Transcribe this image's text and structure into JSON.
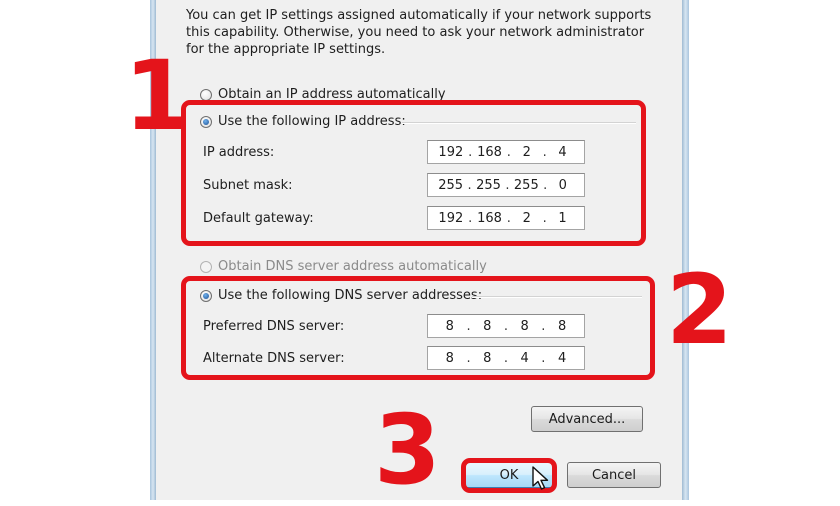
{
  "dialog": {
    "intro_line1": "You can get IP settings assigned automatically if your network supports",
    "intro_line2": "this capability. Otherwise, you need to ask your network administrator",
    "intro_line3": "for the appropriate IP settings.",
    "obtain_ip_auto": "Obtain an IP address automatically",
    "use_following_ip": "Use the following IP address:",
    "ip_address_label": "IP address:",
    "ip_address": [
      "192",
      "168",
      "2",
      "4"
    ],
    "subnet_mask_label": "Subnet mask:",
    "subnet_mask": [
      "255",
      "255",
      "255",
      "0"
    ],
    "default_gateway_label": "Default gateway:",
    "default_gateway": [
      "192",
      "168",
      "2",
      "1"
    ],
    "obtain_dns_auto": "Obtain DNS server address automatically",
    "use_following_dns": "Use the following DNS server addresses:",
    "preferred_dns_label": "Preferred DNS server:",
    "preferred_dns": [
      "8",
      "8",
      "8",
      "8"
    ],
    "alternate_dns_label": "Alternate DNS server:",
    "alternate_dns": [
      "8",
      "8",
      "4",
      "4"
    ],
    "advanced_button": "Advanced...",
    "ok_button": "OK",
    "cancel_button": "Cancel"
  },
  "annotations": {
    "step1": "1",
    "step2": "2",
    "step3": "3",
    "highlight_color": "#e4141b"
  }
}
